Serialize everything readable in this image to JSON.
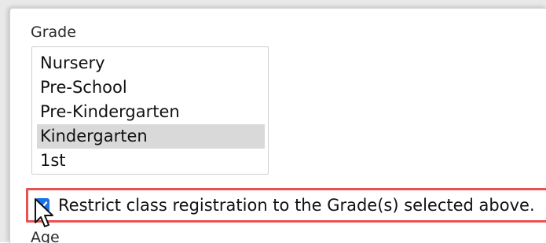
{
  "grade": {
    "label": "Grade",
    "options": [
      {
        "label": "Nursery",
        "selected": false
      },
      {
        "label": "Pre-School",
        "selected": false
      },
      {
        "label": "Pre-Kindergarten",
        "selected": false
      },
      {
        "label": "Kindergarten",
        "selected": true
      },
      {
        "label": "1st",
        "selected": false
      }
    ]
  },
  "restrict": {
    "checked": true,
    "label": "Restrict class registration to the Grade(s) selected above.",
    "highlight_color": "#e8514f"
  },
  "next_field": {
    "label": "Age"
  },
  "colors": {
    "checkbox_accent": "#1a73e8",
    "selected_option_bg": "#d9d9d9"
  },
  "icons": {
    "checkmark": "check-icon",
    "pointer": "mouse-pointer-icon"
  }
}
